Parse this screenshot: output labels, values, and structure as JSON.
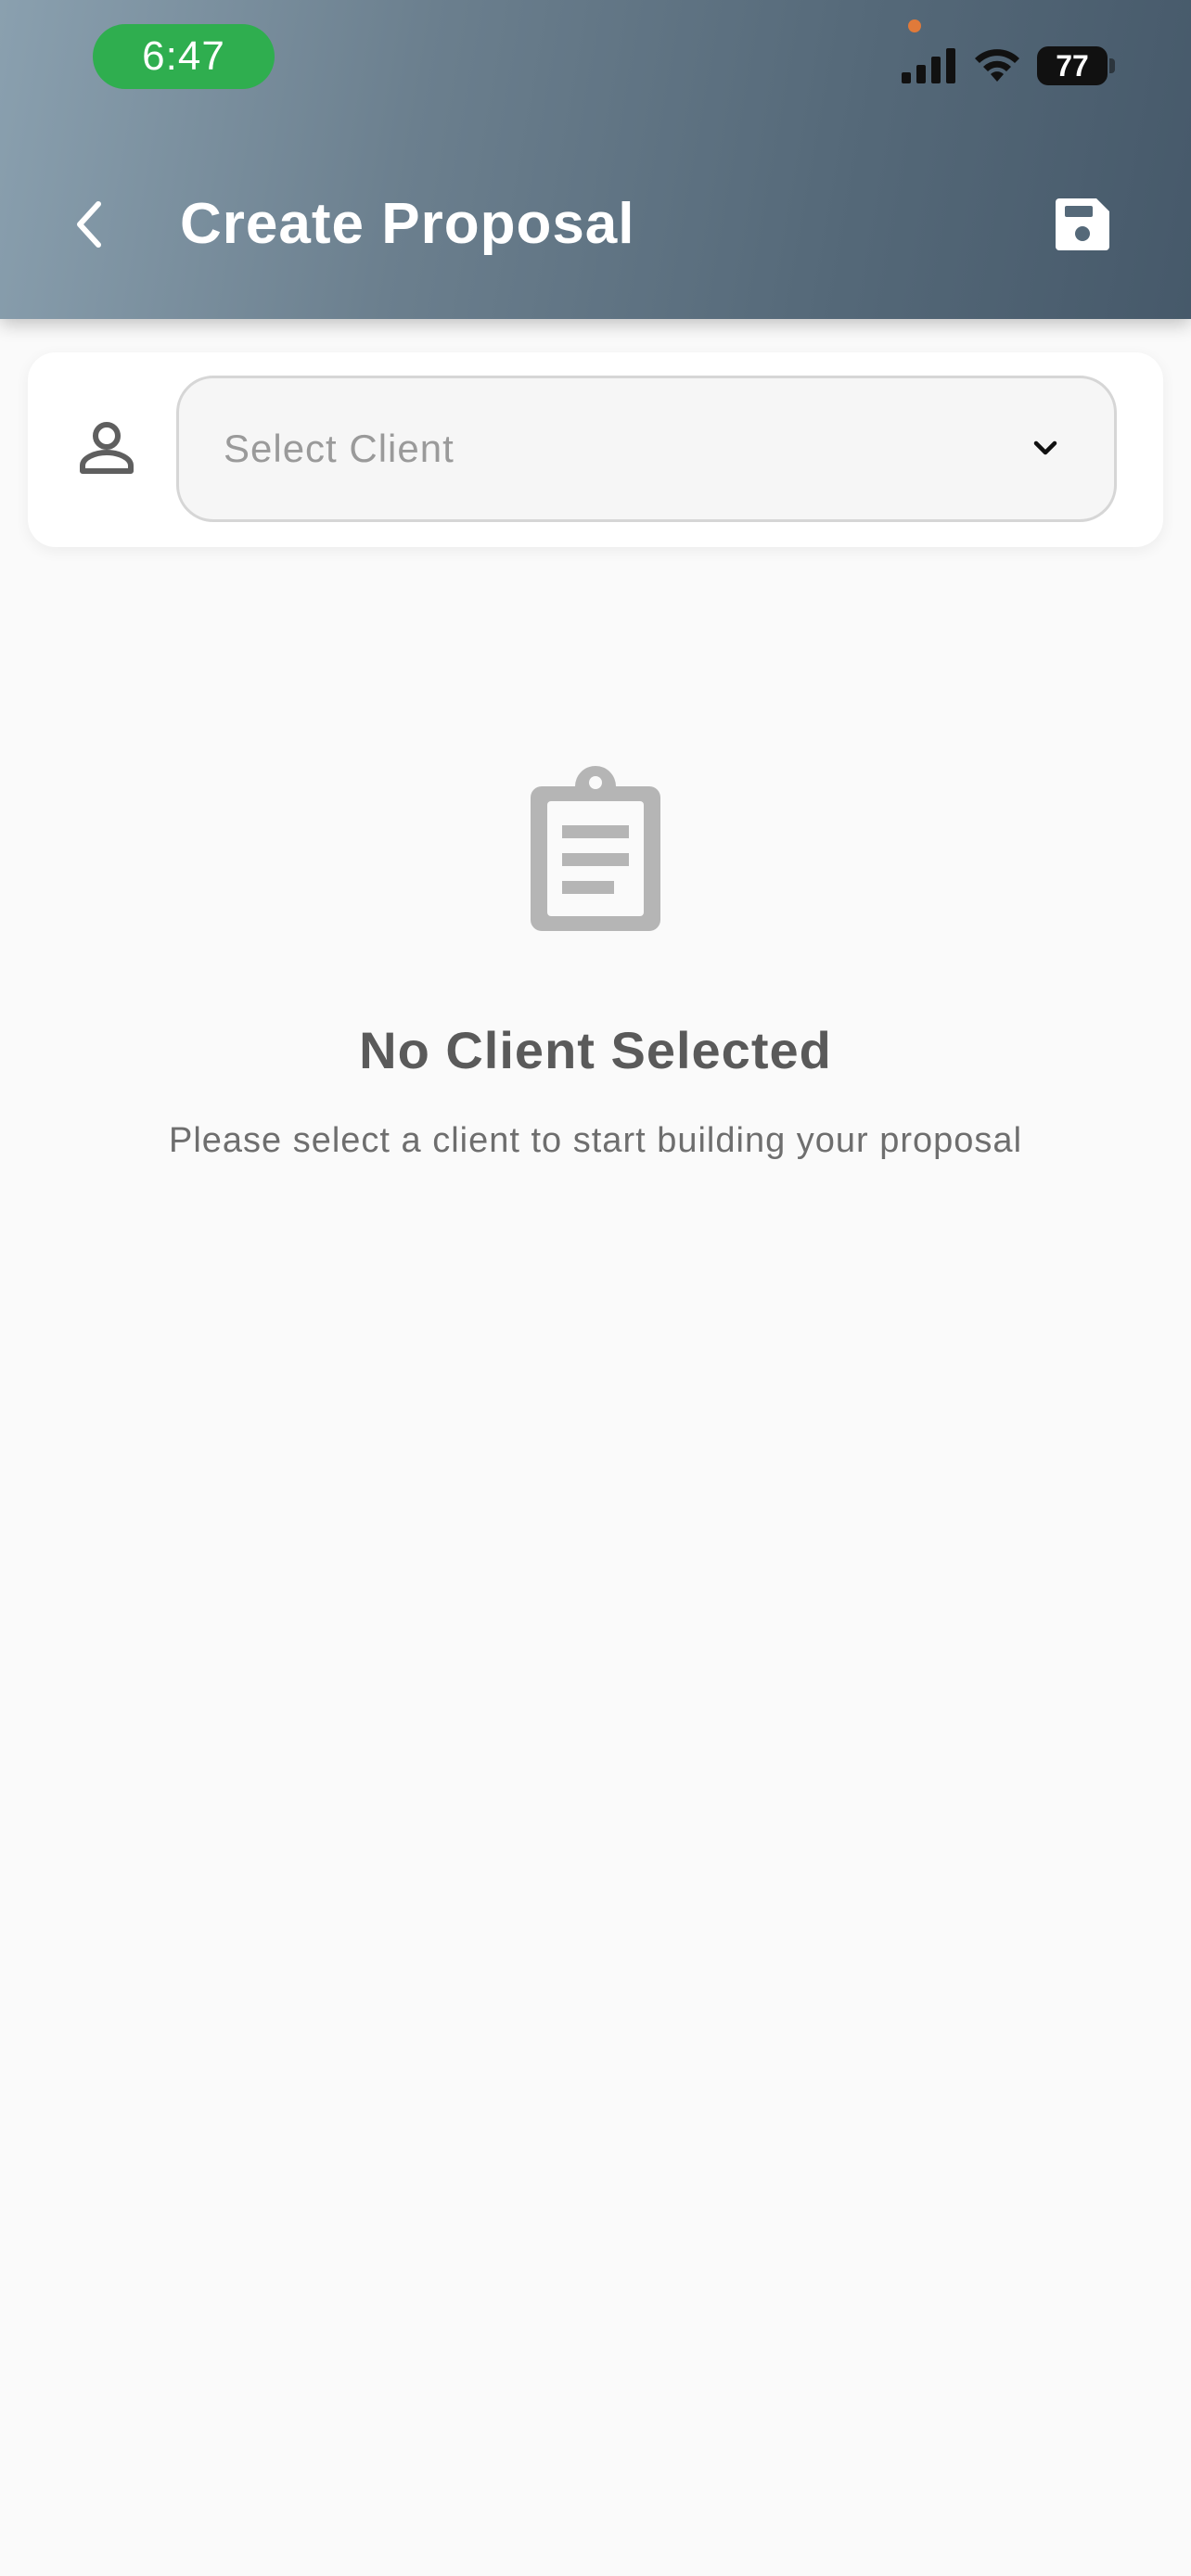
{
  "status_bar": {
    "time": "6:47",
    "battery": "77",
    "icons": [
      "signal-icon",
      "wifi-icon",
      "battery-icon"
    ]
  },
  "header": {
    "title": "Create Proposal",
    "back_icon": "chevron-left-icon",
    "save_icon": "floppy-disk-icon"
  },
  "client_selector": {
    "placeholder": "Select Client",
    "icon": "person-icon",
    "dropdown_icon": "chevron-down-icon"
  },
  "empty_state": {
    "icon": "clipboard-icon",
    "title": "No Client Selected",
    "message": "Please select a client to start building your proposal"
  },
  "colors": {
    "header_gradient_start": "#8aa0af",
    "header_gradient_end": "#46596a",
    "time_pill": "#2fae4f",
    "background": "#fafafa",
    "empty_icon": "#b5b5b5"
  }
}
